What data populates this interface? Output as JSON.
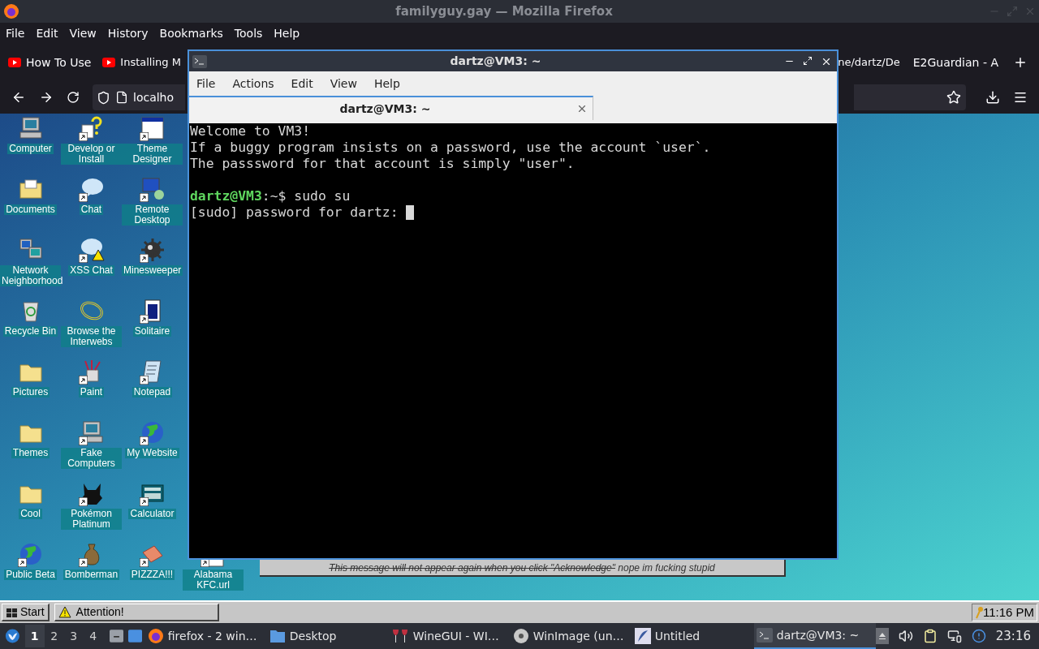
{
  "firefox": {
    "title": "familyguy.gay — Mozilla Firefox",
    "menu": [
      "File",
      "Edit",
      "View",
      "History",
      "Bookmarks",
      "Tools",
      "Help"
    ],
    "tabs": [
      {
        "label": "How To Use",
        "kind": "youtube"
      },
      {
        "label": "Installing M",
        "kind": "youtube"
      },
      {
        "label": "ne/dartz/De",
        "kind": "plain"
      },
      {
        "label": "E2Guardian - A",
        "kind": "plain"
      }
    ],
    "url": "localho"
  },
  "desktop_icons": [
    {
      "label": "Computer",
      "kind": "computer",
      "shortcut": false
    },
    {
      "label": "Documents",
      "kind": "folder-open",
      "shortcut": false
    },
    {
      "label": "Network Neighborhood",
      "kind": "network",
      "shortcut": false
    },
    {
      "label": "Recycle Bin",
      "kind": "recycle",
      "shortcut": false
    },
    {
      "label": "Pictures",
      "kind": "folder",
      "shortcut": false
    },
    {
      "label": "Themes",
      "kind": "folder",
      "shortcut": false
    },
    {
      "label": "Cool",
      "kind": "folder",
      "shortcut": false
    },
    {
      "label": "Public Beta",
      "kind": "globe",
      "shortcut": true
    },
    {
      "label": "Develop or Install",
      "kind": "question-doc",
      "shortcut": true
    },
    {
      "label": "Chat",
      "kind": "chat",
      "shortcut": true
    },
    {
      "label": "XSS Chat",
      "kind": "chat-warning",
      "shortcut": true
    },
    {
      "label": "Browse the Interwebs",
      "kind": "ring",
      "shortcut": false
    },
    {
      "label": "Paint",
      "kind": "paint",
      "shortcut": true
    },
    {
      "label": "Fake Computers",
      "kind": "computer",
      "shortcut": true
    },
    {
      "label": "Pokémon Platinum",
      "kind": "creature",
      "shortcut": true
    },
    {
      "label": "Bomberman",
      "kind": "sack",
      "shortcut": true
    },
    {
      "label": "Theme Designer",
      "kind": "window",
      "shortcut": true
    },
    {
      "label": "Remote Desktop",
      "kind": "monitor",
      "shortcut": true
    },
    {
      "label": "Minesweeper",
      "kind": "mine",
      "shortcut": true
    },
    {
      "label": "Solitaire",
      "kind": "card",
      "shortcut": true
    },
    {
      "label": "Notepad",
      "kind": "notepad",
      "shortcut": true
    },
    {
      "label": "My Website",
      "kind": "globe",
      "shortcut": true
    },
    {
      "label": "Calculator",
      "kind": "calculator",
      "shortcut": true
    },
    {
      "label": "PIZZZA!!!",
      "kind": "pizza",
      "shortcut": true
    },
    {
      "label": "Alabama KFC.url",
      "kind": "page",
      "shortcut": true
    }
  ],
  "message": {
    "struck_text": "This message will not appear again when you click \"Acknowledge\"",
    "text": " nope im fucking stupid"
  },
  "terminal": {
    "title": "dartz@VM3: ~",
    "menu": [
      "File",
      "Actions",
      "Edit",
      "View",
      "Help"
    ],
    "tab": "dartz@VM3: ~",
    "lines": [
      {
        "kind": "text",
        "text": "Welcome to VM3!"
      },
      {
        "kind": "text",
        "text": "If a buggy program insists on a password, use the account `user`."
      },
      {
        "kind": "text",
        "text": "The passsword for that account is simply \"user\"."
      },
      {
        "kind": "blank"
      },
      {
        "kind": "prompt",
        "user": "dartz@VM3",
        "text": ":~$ sudo su"
      },
      {
        "kind": "input",
        "text": "[sudo] password for dartz: ",
        "cursor": true
      }
    ]
  },
  "win98_taskbar": {
    "start": "Start",
    "buttons": [
      "Attention!"
    ],
    "clock": "11:16 PM"
  },
  "panel": {
    "workspaces": [
      {
        "label": "1",
        "selected": true
      },
      {
        "label": "2",
        "selected": false
      },
      {
        "label": "3",
        "selected": false
      },
      {
        "label": "4",
        "selected": false
      }
    ],
    "tasks": [
      {
        "label": "firefox - 2 win…",
        "kind": "firefox",
        "selected": false
      },
      {
        "label": "Desktop",
        "kind": "folder",
        "selected": false
      },
      {
        "label": "WineGUI - WI…",
        "kind": "glasses",
        "selected": false
      },
      {
        "label": "WinImage (un…",
        "kind": "disc",
        "selected": false
      },
      {
        "label": "Untitled",
        "kind": "feather",
        "selected": false
      },
      {
        "label": "dartz@VM3: ~",
        "kind": "terminal",
        "selected": true
      }
    ],
    "clock": "23:16"
  }
}
